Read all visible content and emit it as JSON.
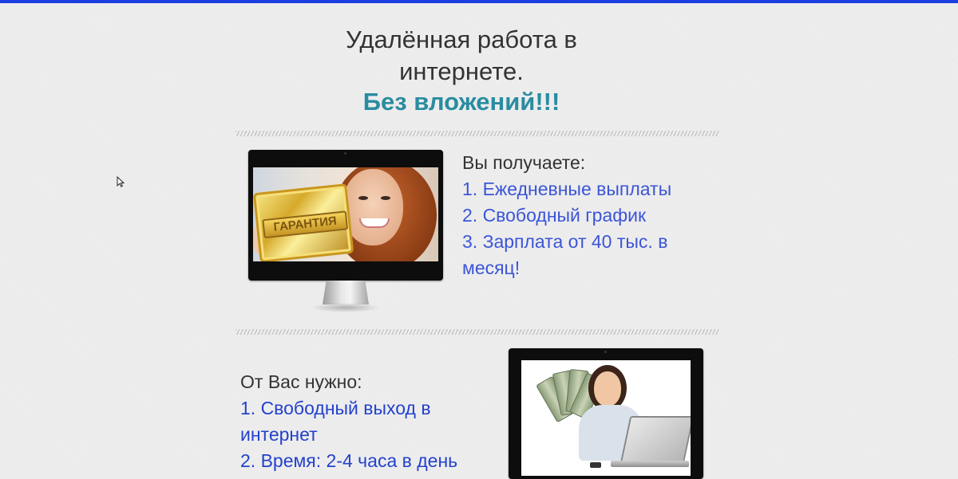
{
  "header": {
    "title_line1": "Удалённая работа в",
    "title_line2": "интернете.",
    "subtitle": "Без вложений!!!"
  },
  "section1": {
    "image_caption": "ГАРАНТИЯ",
    "heading": "Вы получаете:",
    "items": [
      "1. Ежедневные выплаты",
      "2. Свободный график",
      "3. Зарплата от 40 тыс. в месяц!"
    ]
  },
  "section2": {
    "heading": "От Вас нужно:",
    "items": [
      "1. Свободный выход в интернет",
      "2. Время: 2-4 часа в день"
    ]
  },
  "colors": {
    "top_bar": "#1d3fe0",
    "subtitle": "#2a8ca0",
    "list_item": "#3c55d6"
  },
  "icons": {
    "cursor": "mouse-pointer-icon"
  }
}
